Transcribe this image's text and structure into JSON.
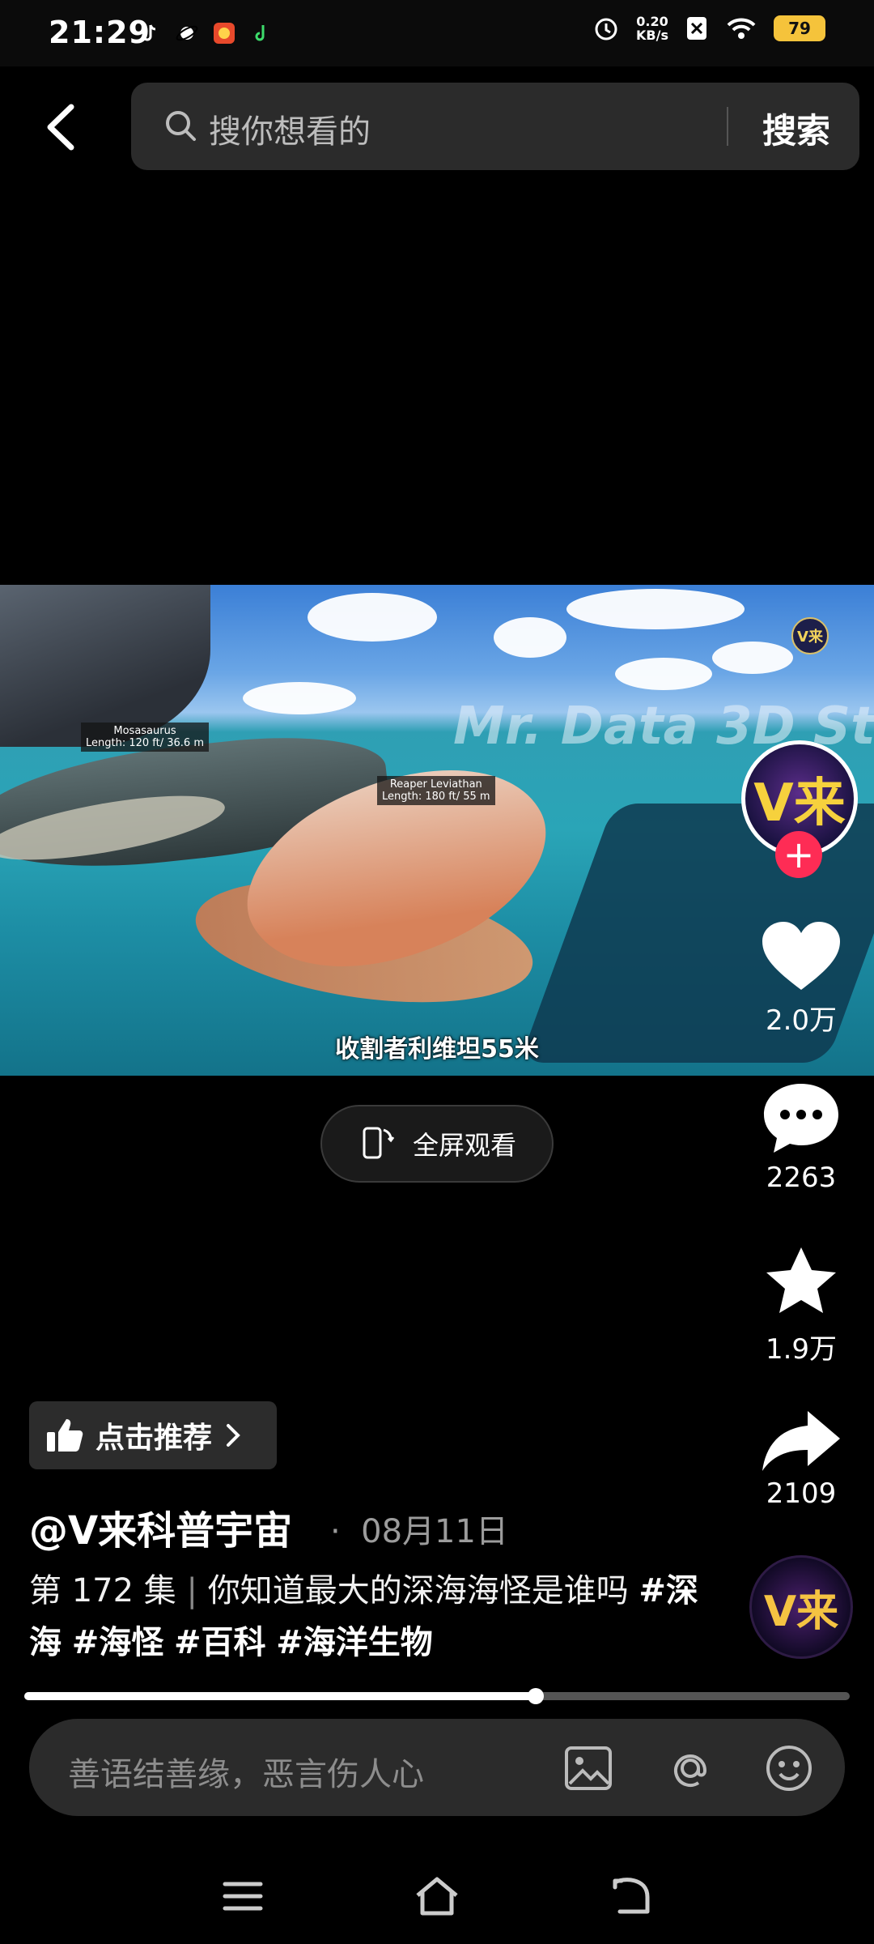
{
  "status_bar": {
    "time": "21:29",
    "net_speed_value": "0.20",
    "net_speed_unit": "KB/s",
    "battery": "79"
  },
  "search": {
    "placeholder": "搜你想看的",
    "button": "搜索"
  },
  "video": {
    "watermark": "Mr. Data 3D St",
    "channel_mark": "V来",
    "subtitle": "收割者利维坦55米",
    "tag_mosasaurus_name": "Mosasaurus",
    "tag_mosasaurus_len": "Length: 120 ft/ 36.6 m",
    "tag_reaper_name": "Reaper Leviathan",
    "tag_reaper_len": "Length: 180 ft/ 55 m"
  },
  "fullscreen_label": "全屏观看",
  "rail": {
    "avatar_text": "V来",
    "likes": "2.0万",
    "comments": "2263",
    "favorites": "1.9万",
    "shares": "2109",
    "music_disc_text": "V来"
  },
  "recommend_label": "点击推荐",
  "author": "@V来科普宇宙",
  "date": "08月11日",
  "description": {
    "episode": "第 172 集",
    "separator": "|",
    "text": "你知道最大的深海海怪是谁吗",
    "tags": [
      "#深海",
      "#海怪",
      "#百科",
      "#海洋生物"
    ]
  },
  "progress": 0.62,
  "comment_placeholder": "善语结善缘，恶言伤人心",
  "colors": {
    "accent": "#fe2c55",
    "background": "#000000",
    "pill": "#2b2b2b"
  },
  "icons": [
    "back-icon",
    "search-icon",
    "heart-icon",
    "comment-icon",
    "star-icon",
    "share-icon",
    "image-icon",
    "at-icon",
    "emoji-icon",
    "menu-icon",
    "home-icon",
    "back-nav-icon",
    "thumbs-up-icon",
    "chevron-right-icon",
    "rotate-phone-icon"
  ]
}
